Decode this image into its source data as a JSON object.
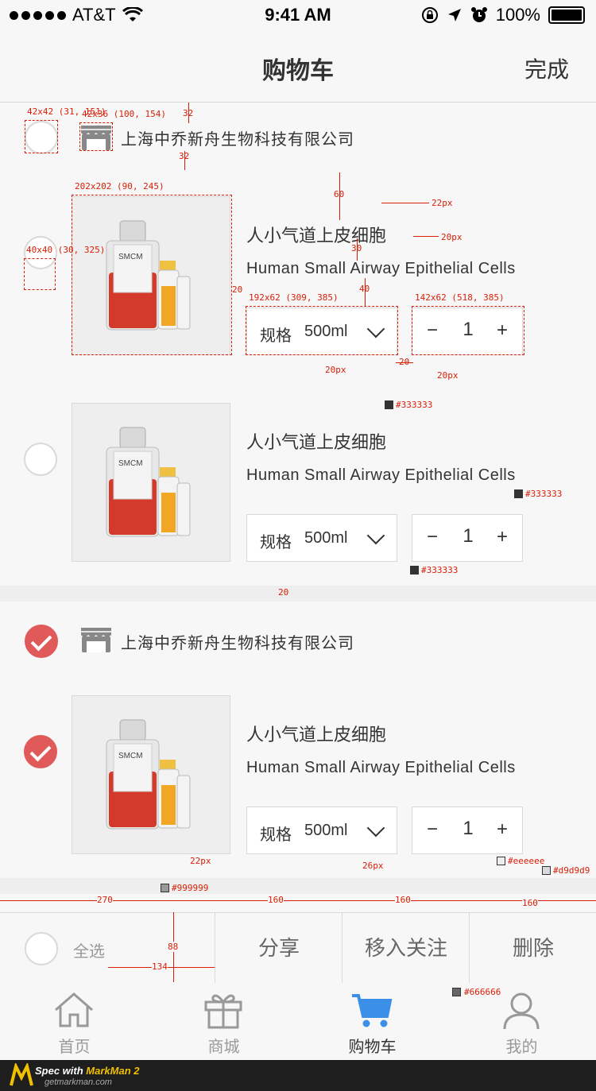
{
  "status_bar": {
    "carrier": "AT&T",
    "time": "9:41 AM",
    "battery": "100%"
  },
  "nav": {
    "title": "购物车",
    "done_label": "完成"
  },
  "shops": [
    {
      "name": "上海中乔新舟生物科技有限公司",
      "checked": false,
      "items": [
        {
          "title": "人小气道上皮细胞",
          "subtitle": "Human Small Airway Epithelial Cells",
          "spec_label": "规格",
          "spec_value": "500ml",
          "qty": "1",
          "checked": false
        },
        {
          "title": "人小气道上皮细胞",
          "subtitle": "Human Small Airway Epithelial Cells",
          "spec_label": "规格",
          "spec_value": "500ml",
          "qty": "1",
          "checked": false
        }
      ]
    },
    {
      "name": "上海中乔新舟生物科技有限公司",
      "checked": true,
      "items": [
        {
          "title": "人小气道上皮细胞",
          "subtitle": "Human Small Airway Epithelial Cells",
          "spec_label": "规格",
          "spec_value": "500ml",
          "qty": "1",
          "checked": true
        }
      ]
    }
  ],
  "product_image": {
    "bottle_label": "SMCM"
  },
  "qty_controls": {
    "minus": "−",
    "plus": "+"
  },
  "action_bar": {
    "select_all": "全选",
    "share": "分享",
    "move_to_favorites": "移入关注",
    "delete": "删除"
  },
  "tab_bar": {
    "items": [
      {
        "label": "首页",
        "icon": "home-icon"
      },
      {
        "label": "商城",
        "icon": "gift-icon"
      },
      {
        "label": "购物车",
        "icon": "cart-icon"
      },
      {
        "label": "我的",
        "icon": "user-icon"
      }
    ],
    "active_index": 2
  },
  "colors": {
    "accent_red": "#e05a5a",
    "active_tab_blue": "#3b8fe8",
    "text_dark": "#333333",
    "text_medium": "#666666",
    "text_light": "#999999",
    "divider": "#d9d9d9",
    "gap_bg": "#eeeeee",
    "annotation_red": "#d81e06"
  },
  "footer": {
    "brand_prefix": "Spec with ",
    "brand_name": "MarkMan 2",
    "site": "getmarkman.com"
  },
  "annotations": {
    "a_radio": "42x42 (31, 151)",
    "a_store": "42x36 (100, 154)",
    "a_32a": "32",
    "a_32b": "32",
    "a_img": "202x202 (90, 245)",
    "a_60": "60",
    "a_22px_title": "22px",
    "a_30": "30",
    "a_20px_sub": "20px",
    "a_40v": "40",
    "a_item_radio": "40x40 (30, 325)",
    "a_20_img": "20",
    "a_spec": "192x62 (309, 385)",
    "a_qty": "142x62 (518, 385)",
    "a_20_between": "20",
    "a_20px_spec_l": "20px",
    "a_20px_spec_v": "20px",
    "a_c1": "#333333",
    "a_c2": "#333333",
    "a_c3": "#333333",
    "a_gap20": "20",
    "a_22px_all": "22px",
    "a_c999": "#999999",
    "a_26px": "26px",
    "a_ceee": "#eeeeee",
    "a_cd9": "#d9d9d9",
    "a_270": "270",
    "a_160a": "160",
    "a_160b": "160",
    "a_160c": "160",
    "a_88": "88",
    "a_134": "134",
    "a_c666": "#666666"
  }
}
